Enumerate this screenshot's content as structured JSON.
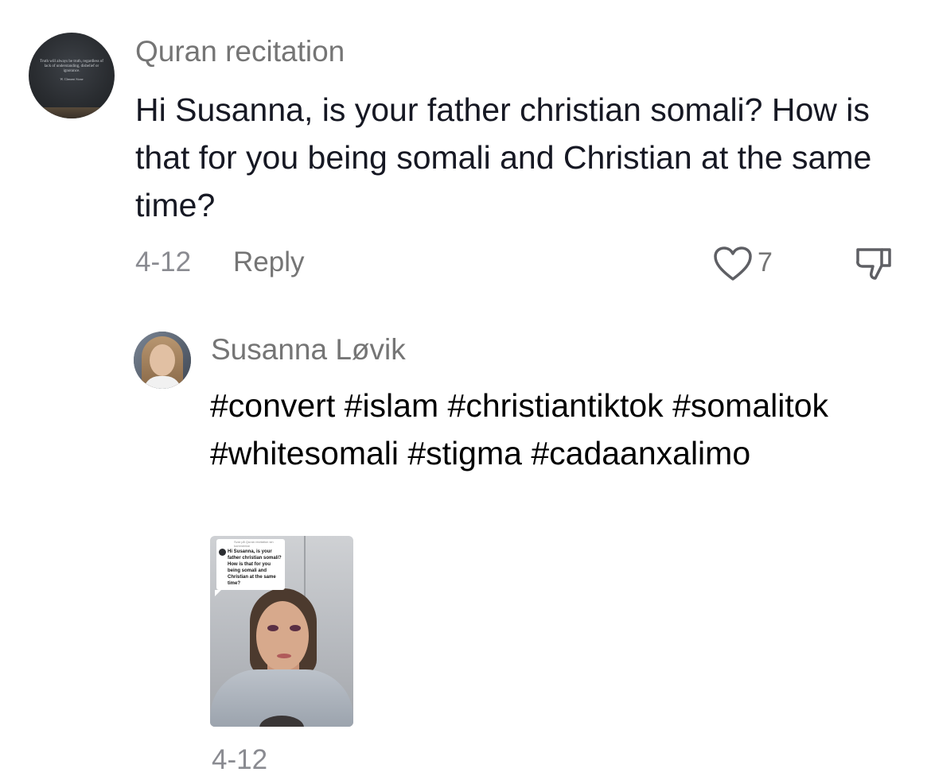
{
  "comment": {
    "author": "Quran recitation",
    "avatar_quote": "Truth will always be truth, regardless of lack of understanding, disbelief or ignorance.",
    "avatar_quote_author": "W. Clement Stone",
    "text": "Hi Susanna, is your father christian somali? How is that for you being somali and Christian at the same time?",
    "date": "4-12",
    "reply_label": "Reply",
    "like_count": "7",
    "icons": {
      "like": "heart-outline-icon",
      "dislike": "thumbs-down-icon"
    }
  },
  "reply": {
    "author": "Susanna Løvik",
    "text": "#convert #islam #christiantiktok #somalitok #whitesomali #stigma #cadaanxalimo",
    "video_thumbnail": {
      "sticker_header": "Svar på Quran recitation sin kommentar",
      "sticker_text": "Hi Susanna, is your father christian somali? How is that for you being somali and Christian at the same time?"
    }
  },
  "next_meta_partial": "4-12"
}
